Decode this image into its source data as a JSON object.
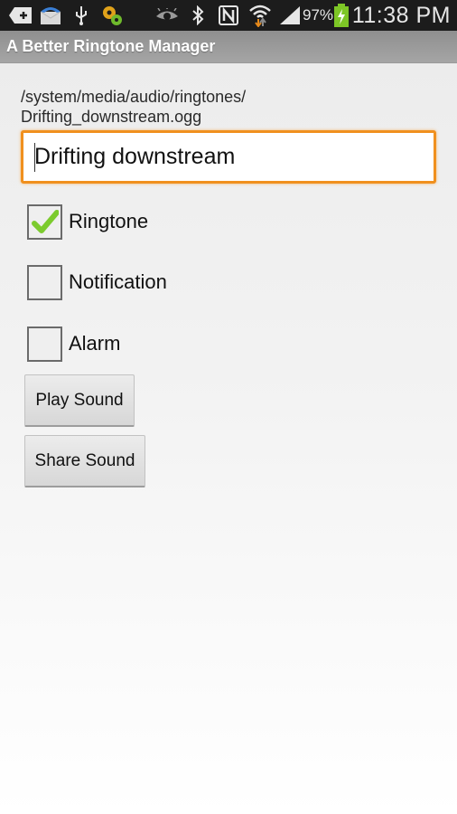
{
  "status_bar": {
    "left_icons": [
      "add-icon",
      "voicemail-icon",
      "usb-icon",
      "settings-gears-icon"
    ],
    "right_icons": [
      "eye-icon",
      "bluetooth-icon",
      "nfc-icon",
      "wifi-icon",
      "signal-icon",
      "battery-charging-icon"
    ],
    "battery_percent": "97%",
    "time": "11:38 PM",
    "colors": {
      "battery": "#7dc626",
      "wifi_down_arrow": "#e88a1a"
    }
  },
  "app": {
    "title": "A Better Ringtone Manager"
  },
  "file": {
    "path_line1": "/system/media/audio/ringtones/",
    "path_line2": "Drifting_downstream.ogg"
  },
  "name_field": {
    "value": "Drifting downstream",
    "focus_color": "#f0901e"
  },
  "checkboxes": [
    {
      "label": "Ringtone",
      "checked": true
    },
    {
      "label": "Notification",
      "checked": false
    },
    {
      "label": "Alarm",
      "checked": false
    }
  ],
  "buttons": {
    "play_label": "Play Sound",
    "share_label": "Share Sound"
  },
  "accent_colors": {
    "checkmark": "#7ccb2e"
  }
}
